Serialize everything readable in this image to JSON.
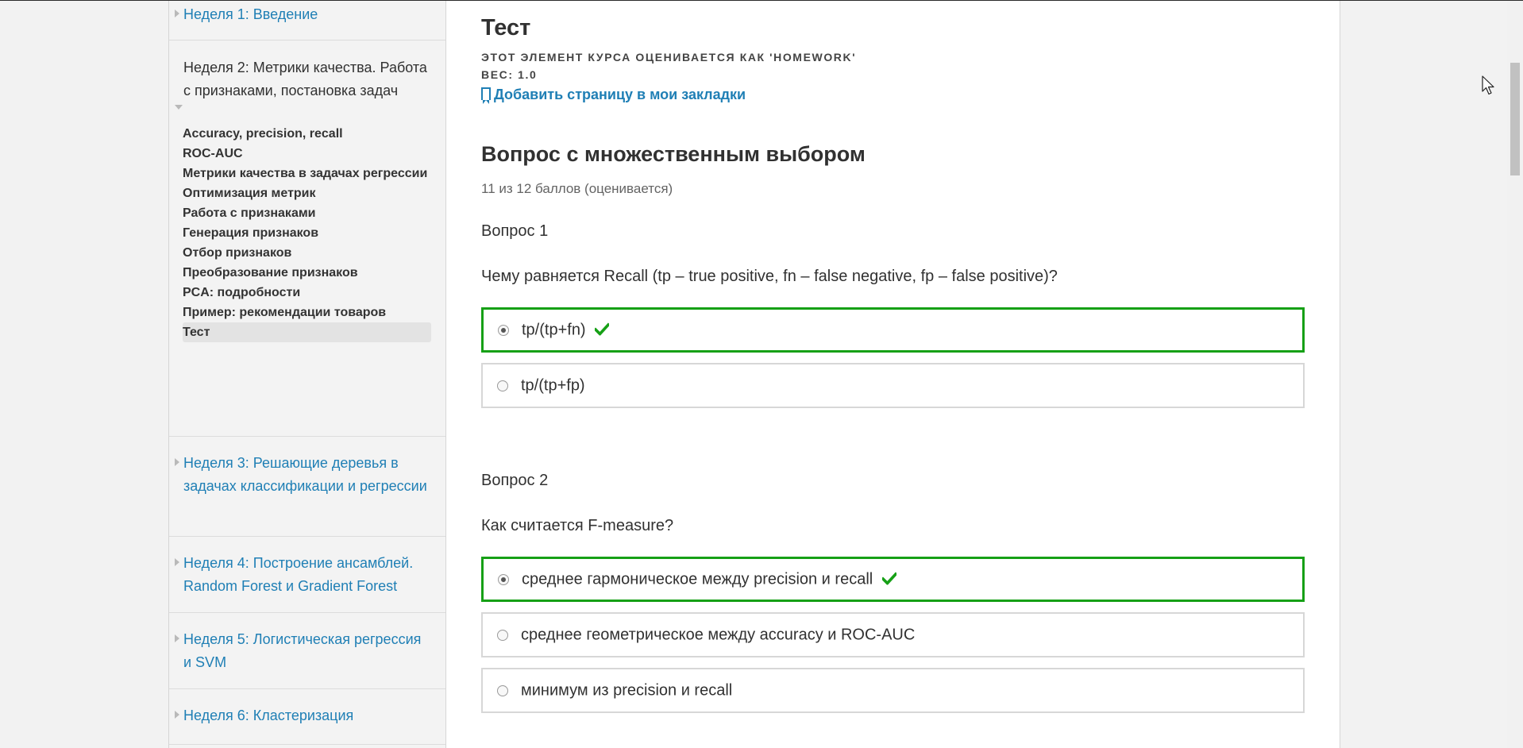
{
  "sidebar": {
    "week1": "Неделя 1: Введение",
    "week2": "Неделя 2: Метрики качества. Работа с признаками, постановка задач",
    "week2_items": [
      "Accuracy, precision, recall",
      "ROC-AUC",
      "Метрики качества в задачах регрессии",
      "Оптимизация метрик",
      "Работа с признаками",
      "Генерация признаков",
      "Отбор признаков",
      "Преобразование признаков",
      "PCA: подробности",
      "Пример: рекомендации товаров",
      "Тест"
    ],
    "week3": "Неделя 3: Решающие деревья в задачах классификации и регрессии",
    "week4": "Неделя 4: Построение ансамблей. Random Forest и Gradient Forest",
    "week5": "Неделя 5: Логистическая регрессия и SVM",
    "week6": "Неделя 6: Кластеризация"
  },
  "main": {
    "title": "Тест",
    "graded_as": "ЭТОТ ЭЛЕМЕНТ КУРСА ОЦЕНИВАЕТСЯ КАК 'HOMEWORK'",
    "weight": "ВЕС: 1.0",
    "bookmark": "Добавить страницу в мои закладки",
    "problem_title": "Вопрос с множественным выбором",
    "score": "11 из 12 баллов (оценивается)",
    "questions": [
      {
        "label": "Вопрос 1",
        "text": "Чему равняется Recall (tp – true positive, fn – false negative, fp – false positive)?",
        "choices": [
          "tp/(tp+fn)",
          "tp/(tp+fp)"
        ]
      },
      {
        "label": "Вопрос 2",
        "text": "Как считается F-measure?",
        "choices": [
          "среднее гармоническое между precision и recall",
          "среднее геометрическое между accuracy и ROC-AUC",
          "минимум из precision и recall"
        ]
      }
    ]
  },
  "colors": {
    "link": "#1f7fb5",
    "correct": "#16a016"
  }
}
